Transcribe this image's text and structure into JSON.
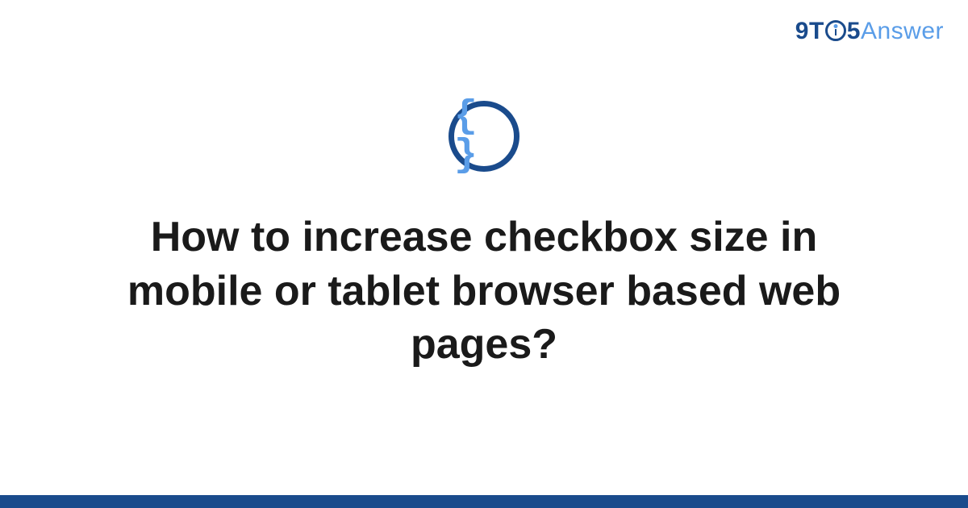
{
  "logo": {
    "part1": "9",
    "part2": "T",
    "part3": "5",
    "part4": "Answer"
  },
  "icon": {
    "name": "code-braces-icon",
    "glyph": "{ }"
  },
  "title": "How to increase checkbox size in mobile or tablet browser based web pages?",
  "colors": {
    "primary": "#1a4b8c",
    "accent": "#5a9de8",
    "text": "#1a1a1a"
  }
}
